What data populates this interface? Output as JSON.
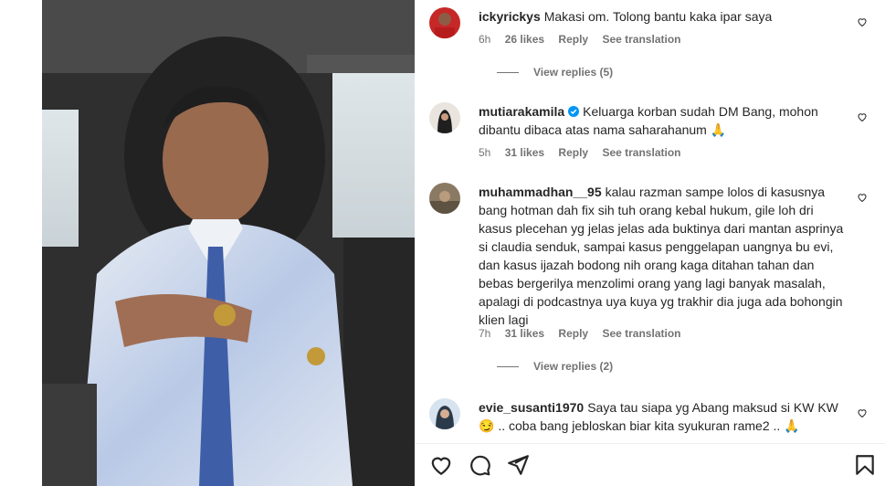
{
  "comments": [
    {
      "username": "ickyrickys",
      "text": "Makasi om. Tolong bantu kaka ipar saya",
      "time": "6h",
      "likes": "26 likes",
      "reply": "Reply",
      "translate": "See translation",
      "view_replies": "View replies (5)"
    },
    {
      "username": "mutiarakamila",
      "text": "Keluarga korban sudah DM Bang, mohon dibantu dibaca atas nama saharahanum 🙏",
      "time": "5h",
      "likes": "31 likes",
      "reply": "Reply",
      "translate": "See translation"
    },
    {
      "username": "muhammadhan__95",
      "text": "kalau razman sampe lolos di kasusnya bang hotman dah fix sih tuh orang kebal hukum, gile loh dri kasus plecehan yg jelas jelas ada buktinya dari mantan asprinya si claudia senduk, sampai kasus penggelapan uangnya bu evi, dan kasus ijazah bodong nih orang kaga ditahan tahan dan bebas bergerilya menzolimi orang yang lagi banyak masalah, apalagi di podcastnya uya kuya yg trakhir dia juga ada bohongin klien lagi",
      "time": "7h",
      "likes": "31 likes",
      "reply": "Reply",
      "translate": "See translation",
      "view_replies": "View replies (2)"
    },
    {
      "username": "evie_susanti1970",
      "text": "Saya tau siapa yg Abang maksud si KW KW 😏 .. coba bang jebloskan biar kita syukuran rame2 .. 🙏"
    }
  ],
  "colors": {
    "text": "#262626",
    "muted": "#737373",
    "verified": "#0095f6"
  }
}
